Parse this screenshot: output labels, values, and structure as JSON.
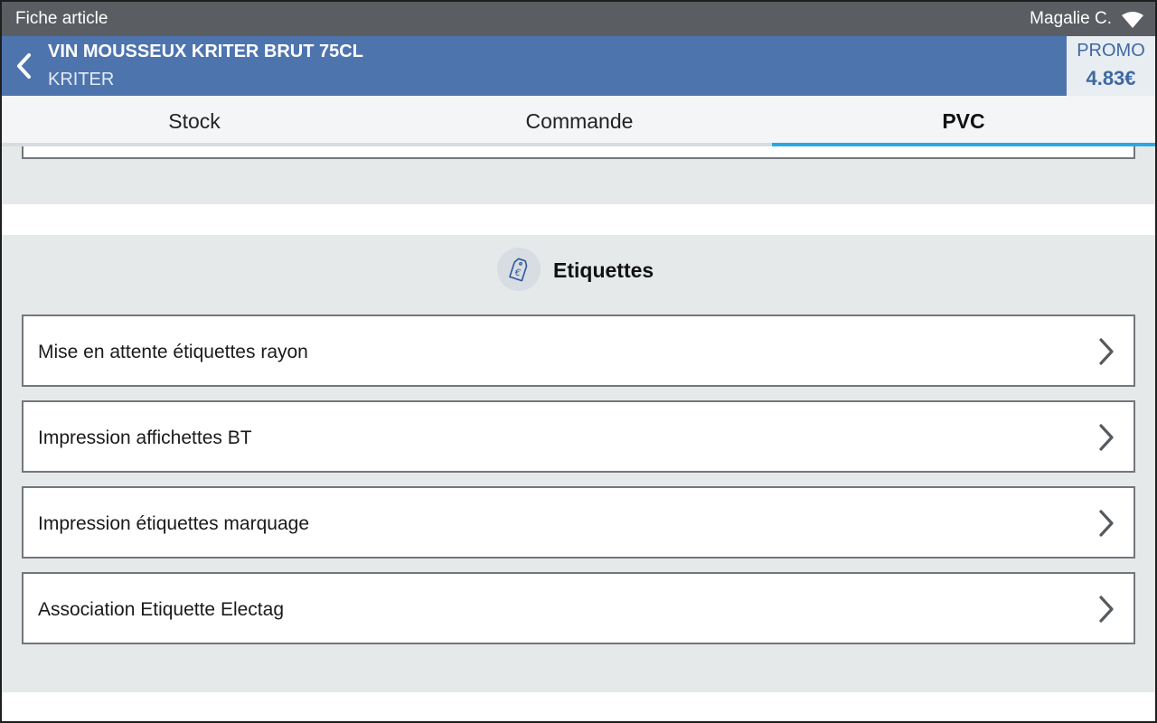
{
  "statusbar": {
    "title": "Fiche article",
    "user": "Magalie C."
  },
  "header": {
    "product_name": "VIN MOUSSEUX KRITER BRUT 75CL",
    "brand": "KRITER",
    "promo_label": "PROMO",
    "promo_price": "4.83€"
  },
  "tabs": [
    {
      "label": "Stock",
      "active": false
    },
    {
      "label": "Commande",
      "active": false
    },
    {
      "label": "PVC",
      "active": true
    }
  ],
  "section": {
    "title": "Etiquettes",
    "items": [
      {
        "label": "Mise en attente étiquettes rayon"
      },
      {
        "label": "Impression affichettes BT"
      },
      {
        "label": "Impression étiquettes marquage"
      },
      {
        "label": "Association Etiquette Electag"
      }
    ]
  },
  "colors": {
    "statusbar": "#5a5e63",
    "header": "#4e74ae",
    "accent": "#29a9e4",
    "promo": "#3f68a3",
    "section_bg": "#e6e9ea"
  },
  "icons": {
    "wifi": "wifi-icon",
    "back": "chevron-left-icon",
    "section": "euro-tag-icon",
    "row": "chevron-right-icon"
  }
}
